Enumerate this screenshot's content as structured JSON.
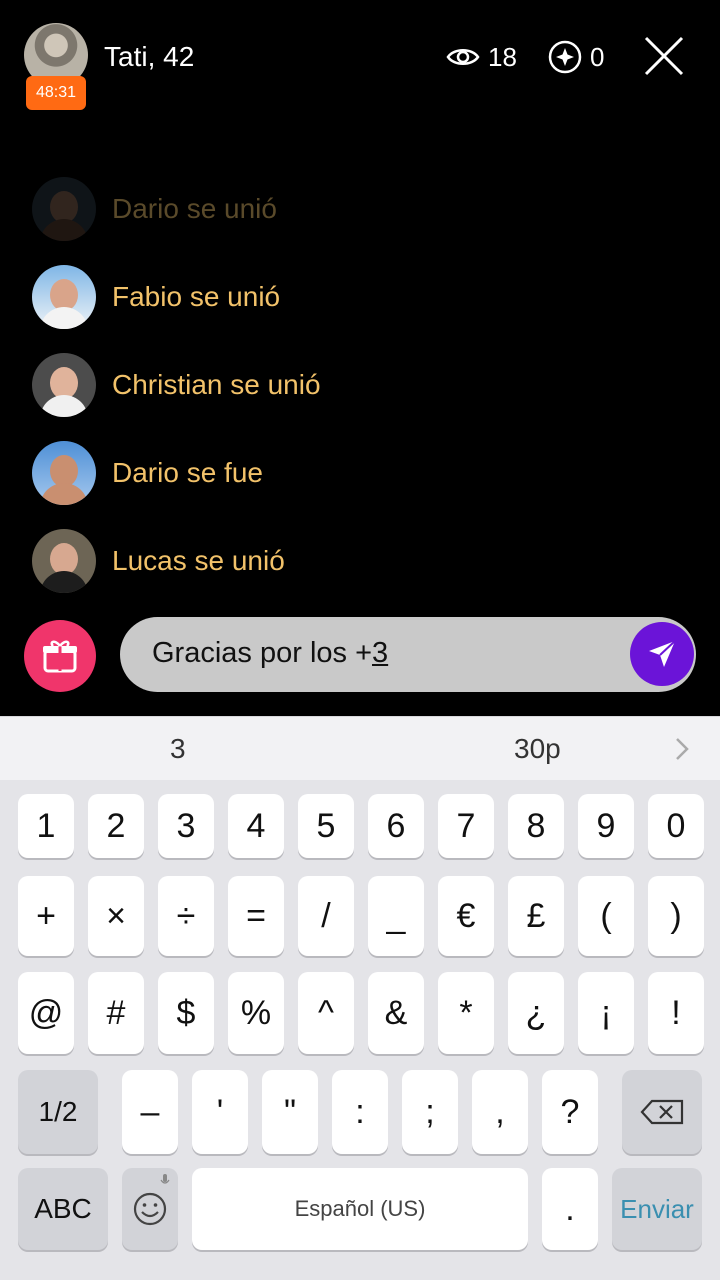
{
  "header": {
    "host_name": "Tati, 42",
    "timer": "48:31",
    "viewers_count": "18",
    "points_count": "0"
  },
  "feed": [
    {
      "text": "Dario se unió",
      "faded": true
    },
    {
      "text": "Fabio se unió",
      "faded": false
    },
    {
      "text": "Christian se unió",
      "faded": false
    },
    {
      "text": "Dario se fue",
      "faded": false
    },
    {
      "text": "Lucas se unió",
      "faded": false
    }
  ],
  "composer": {
    "text_main": "Gracias por los +",
    "text_underlined": "3"
  },
  "keyboard": {
    "suggestions": [
      "3",
      "30p"
    ],
    "row1": [
      "1",
      "2",
      "3",
      "4",
      "5",
      "6",
      "7",
      "8",
      "9",
      "0"
    ],
    "row2": [
      "+",
      "×",
      "÷",
      "=",
      "/",
      "_",
      "€",
      "£",
      "(",
      ")"
    ],
    "row3": [
      "@",
      "#",
      "$",
      "%",
      "^",
      "&",
      "*",
      "¿",
      "¡",
      "!"
    ],
    "row4": [
      "1/2",
      "–",
      "'",
      "\"",
      ":",
      ";",
      ",",
      "?"
    ],
    "abc_label": "ABC",
    "space_label": "Español (US)",
    "period_label": ".",
    "enviar_label": "Enviar"
  },
  "colors": {
    "feed_text": "#f2c26a",
    "timer_bg": "#ff6a13",
    "gift_bg": "#f0356b",
    "send_bg": "#6b14d8",
    "enviar_text": "#3a8fb0"
  }
}
